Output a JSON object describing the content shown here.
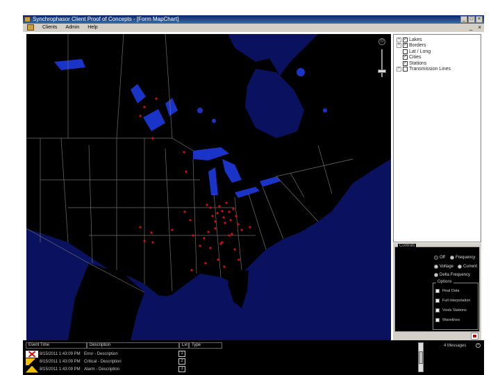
{
  "window": {
    "title": "Synchrophasor Client Proof of Concepts - [Form MapChart]",
    "controls": [
      "_",
      "□",
      "×"
    ]
  },
  "menu": {
    "items": [
      "Clients",
      "Admin",
      "Help"
    ],
    "mdi_controls": [
      "_",
      "×"
    ]
  },
  "map": {
    "zoom_reset_glyph": "⊙",
    "zoom_level": 0.2,
    "land_color": "#000000",
    "ocean_color": "#0a1260",
    "lake_color": "#1a34c8",
    "border_color": "#707070",
    "station_color": "#d01010"
  },
  "layers": [
    {
      "label": "Lakes",
      "checked": true,
      "expander": "+"
    },
    {
      "label": "Borders",
      "checked": true,
      "expander": "+"
    },
    {
      "label": "Lat / Long",
      "checked": false,
      "expander": ""
    },
    {
      "label": "Cities",
      "checked": true,
      "expander": ""
    },
    {
      "label": "Stations",
      "checked": true,
      "expander": ""
    },
    {
      "label": "Transmission Lines",
      "checked": false,
      "expander": "+"
    }
  ],
  "controls": {
    "group_label": "Controls",
    "radios": [
      {
        "label": "Off",
        "selected": true
      },
      {
        "label": "Frequency",
        "selected": false
      },
      {
        "label": "Voltage",
        "selected": false
      },
      {
        "label": "Current",
        "selected": false
      },
      {
        "label": "Delta Frequency",
        "selected": false
      }
    ],
    "options_label": "Options",
    "options": [
      "Real Data",
      "Full interpolation",
      "Voids Stations",
      "Wavelines"
    ]
  },
  "events": {
    "headers": [
      "Event Time",
      "Description",
      "Lvl",
      "Type"
    ],
    "rows": [
      {
        "severity": "error",
        "time": "8/15/2011 1:43:09 PM",
        "description": "Error - Description",
        "level": "1"
      },
      {
        "severity": "critical",
        "time": "8/15/2011 1:43:09 PM",
        "description": "Critical - Description",
        "level": "2"
      },
      {
        "severity": "alarm",
        "time": "8/15/2011 1:43:09 PM",
        "description": "Alarm - Description",
        "level": "3"
      }
    ],
    "message_count": "4 Messages",
    "close_glyph": "×"
  }
}
